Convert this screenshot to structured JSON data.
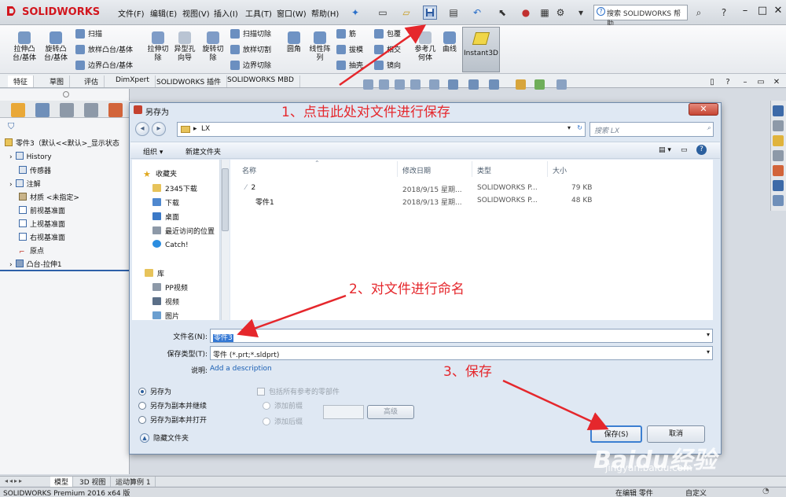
{
  "app": {
    "logo_text": "SOLIDWORKS",
    "menus": [
      "文件(F)",
      "编辑(E)",
      "视图(V)",
      "插入(I)",
      "工具(T)",
      "窗口(W)",
      "帮助(H)"
    ],
    "search_placeholder": "搜索 SOLIDWORKS 帮助",
    "help_label": "?"
  },
  "ribbon": {
    "big_buttons": [
      {
        "label": "拉伸凸\n台/基体"
      },
      {
        "label": "旋转凸\n台/基体"
      },
      {
        "label": "拉伸切\n除"
      },
      {
        "label": "异型孔\n向导"
      },
      {
        "label": "旋转切\n除"
      },
      {
        "label": "圆角"
      },
      {
        "label": "线性阵\n列"
      },
      {
        "label": "参考几\n何体"
      },
      {
        "label": "曲线"
      }
    ],
    "small_buttons": [
      "扫描",
      "放样凸台/基体",
      "边界凸台/基体",
      "扫描切除",
      "放样切割",
      "边界切除",
      "筋",
      "拔模",
      "抽壳",
      "包覆",
      "相交",
      "镜向"
    ],
    "instant3d_label": "Instant3D"
  },
  "tabs": [
    "特征",
    "草图",
    "评估",
    "DimXpert",
    "SOLIDWORKS 插件",
    "SOLIDWORKS MBD"
  ],
  "feature_tree": {
    "root": "零件3（默认<<默认>_显示状态",
    "items": [
      "History",
      "传感器",
      "注解",
      "材质 <未指定>",
      "前视基准面",
      "上视基准面",
      "右视基准面",
      "原点",
      "凸台-拉伸1"
    ]
  },
  "dialog": {
    "title": "另存为",
    "address_path": "LX",
    "search_placeholder": "搜索 LX",
    "organize_label": "组织 ▾",
    "new_folder_label": "新建文件夹",
    "nav": {
      "favorites_header": "收藏夹",
      "favorites": [
        "2345下载",
        "下载",
        "桌面",
        "最近访问的位置",
        "Catch!"
      ],
      "library_header": "库",
      "library": [
        "PP视频",
        "视频",
        "图片"
      ]
    },
    "columns": {
      "name": "名称",
      "modified": "修改日期",
      "type": "类型",
      "size": "大小"
    },
    "files": [
      {
        "name": "2",
        "modified": "2018/9/15 星期...",
        "type": "SOLIDWORKS P...",
        "size": "79 KB"
      },
      {
        "name": "零件1",
        "modified": "2018/9/13 星期...",
        "type": "SOLIDWORKS P...",
        "size": "48 KB"
      }
    ],
    "filename_label": "文件名(N):",
    "filename_value": "零件3",
    "filetype_label": "保存类型(T):",
    "filetype_value": "零件 (*.prt;*.sldprt)",
    "desc_label": "说明:",
    "desc_link": "Add a description",
    "radio_options": [
      "另存为",
      "另存为副本并继续",
      "另存为副本并打开"
    ],
    "include_refs": "包括所有参考的零部件",
    "add_prefix": "添加前缀",
    "add_suffix": "添加后缀",
    "advanced_label": "高级",
    "hide_folders_label": "隐藏文件夹",
    "save_label": "保存(S)",
    "cancel_label": "取消"
  },
  "bottom_tabs": [
    "模型",
    "3D 视图",
    "运动算例 1"
  ],
  "status": {
    "left": "SOLIDWORKS Premium 2016 x64 版",
    "editing": "在编辑 零件",
    "custom": "自定义"
  },
  "annotations": {
    "step1": "1、点击此处对文件进行保存",
    "step2": "2、对文件进行命名",
    "step3": "3、保存"
  },
  "watermark": {
    "brand": "Baidu经验",
    "url": "jingyan.baidu.com"
  },
  "colors": {
    "accent": "#e5272c",
    "brand_red": "#d2161e",
    "selection": "#3478d4"
  }
}
